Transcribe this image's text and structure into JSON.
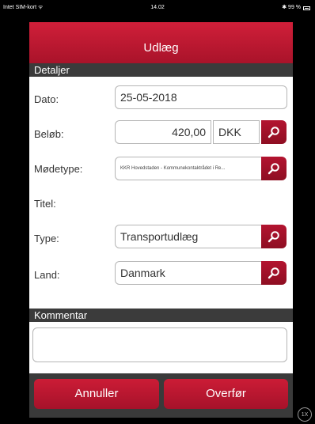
{
  "status_bar": {
    "carrier": "Intet SIM-kort ᯤ",
    "time": "14.02",
    "battery": "✱ 99 %"
  },
  "title": "Udlæg",
  "details_section": {
    "header": "Detaljer",
    "date": {
      "label": "Dato:",
      "value": "25-05-2018"
    },
    "amount": {
      "label": "Beløb:",
      "value": "420,00",
      "currency": "DKK"
    },
    "meeting_type": {
      "label": "Mødetype:",
      "value": "KKR Hovedstaden - Kommunekontaktrådet i Re..."
    },
    "title_field": {
      "label": "Titel:"
    },
    "type": {
      "label": "Type:",
      "value": "Transportudlæg"
    },
    "country": {
      "label": "Land:",
      "value": "Danmark"
    }
  },
  "comment_section": {
    "header": "Kommentar",
    "value": ""
  },
  "footer": {
    "cancel_label": "Annuller",
    "transfer_label": "Overfør"
  },
  "zoom_badge": "1X",
  "icons": {
    "lookup": "search-icon"
  },
  "colors": {
    "accent": "#b3142e",
    "section_header": "#3b3b3b"
  }
}
